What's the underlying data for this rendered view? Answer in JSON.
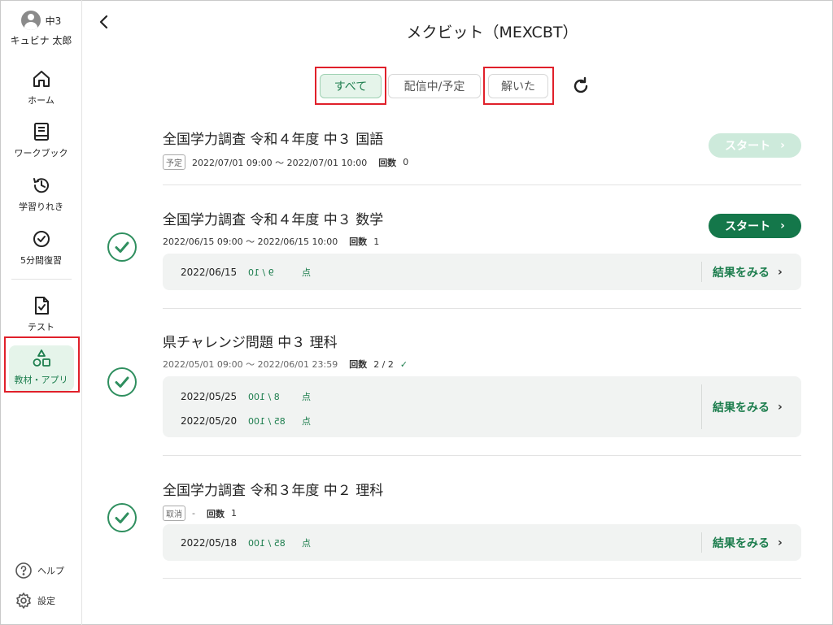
{
  "user": {
    "grade": "中3",
    "name": "キュビナ 太郎"
  },
  "nav": [
    {
      "label": "ホーム",
      "icon": "home-icon"
    },
    {
      "label": "ワークブック",
      "icon": "book-icon"
    },
    {
      "label": "学習りれき",
      "icon": "history-icon"
    },
    {
      "label": "5分間復習",
      "icon": "check-circle-icon"
    },
    {
      "label": "テスト",
      "icon": "test-doc-icon"
    },
    {
      "label": "教材・アプリ",
      "icon": "shapes-icon",
      "active": true
    }
  ],
  "footer": {
    "help": "ヘルプ",
    "settings": "設定"
  },
  "header": {
    "title": "メクビット（MEXCBT）"
  },
  "tabs": {
    "all": "すべて",
    "scheduled": "配信中/予定",
    "solved": "解いた"
  },
  "labels": {
    "count": "回数",
    "start": "スタート",
    "result": "結果をみる",
    "unit": "点"
  },
  "items": [
    {
      "title": "全国学力調査 令和４年度 中３ 国語",
      "tag": "予定",
      "period": "2022/07/01 09:00 〜 2022/07/01 10:00",
      "count": "0",
      "start_enabled": false
    },
    {
      "title": "全国学力調査 令和４年度 中３ 数学",
      "period": "2022/06/15 09:00 〜 2022/06/15 10:00",
      "count": "1",
      "start_enabled": true,
      "results": [
        {
          "date": "2022/06/15",
          "score": "9 / 10"
        }
      ]
    },
    {
      "title": "県チャレンジ問題 中３ 理科",
      "period": "2022/05/01 09:00 〜 2022/06/01 23:59",
      "count": "2 / 2",
      "results": [
        {
          "date": "2022/05/25",
          "score": "8 / 100"
        },
        {
          "date": "2022/05/20",
          "score": "85 / 100"
        }
      ]
    },
    {
      "title": "全国学力調査 令和３年度 中２ 理科",
      "tag": "取消",
      "period": "-",
      "count": "1",
      "results": [
        {
          "date": "2022/05/18",
          "score": "85 / 100"
        }
      ]
    }
  ],
  "colors": {
    "accent": "#1c7d4d",
    "accent_bg": "#e5f4ea",
    "highlight": "#e0202a",
    "start_disabled": "#cdeadb",
    "start_enabled": "#14774a"
  }
}
